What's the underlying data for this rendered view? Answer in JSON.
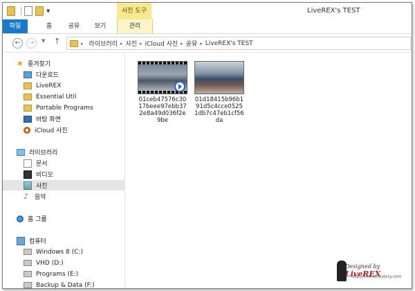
{
  "window": {
    "title": "LiveREX's TEST",
    "context_tab_title": "사진 도구"
  },
  "ribbon": {
    "tabs": [
      {
        "label": "파일",
        "type": "file"
      },
      {
        "label": "홈"
      },
      {
        "label": "공유"
      },
      {
        "label": "보기"
      },
      {
        "label": "관리",
        "type": "context"
      }
    ]
  },
  "address": {
    "crumbs": [
      "라이브러리",
      "사진",
      "iCloud 사진",
      "공유",
      "LiveREX's TEST"
    ]
  },
  "sidebar": {
    "favorites": {
      "header": "즐겨찾기",
      "items": [
        "다운로드",
        "LiveREX",
        "Essential Util",
        "Portable Programs",
        "바탕 화면",
        "iCloud 사진"
      ]
    },
    "libraries": {
      "header": "라이브러리",
      "items": [
        "문서",
        "비디오",
        "사진",
        "음악"
      ],
      "selected": "사진"
    },
    "homegroup": {
      "header": "홈 그룹"
    },
    "computer": {
      "header": "컴퓨터",
      "items": [
        "Windows 8 (C:)",
        "VHD (D:)",
        "Programs (E:)",
        "Backup & Data (F:)"
      ]
    }
  },
  "files": [
    {
      "name": "01ceb47576c3017beee97ebb372e8a49d036f2e9be",
      "kind": "video"
    },
    {
      "name": "01d18415b96b191d5c4cce05251db7c47eb1cf56da",
      "kind": "image"
    }
  ],
  "watermark": {
    "signature": "Designed by",
    "brand": "LiveREX",
    "url": "http://liverex.tistory.com"
  },
  "colors": {
    "file_tab": "#1979ca",
    "context_tab": "#f7e98e",
    "selection": "#e5e5e5"
  }
}
